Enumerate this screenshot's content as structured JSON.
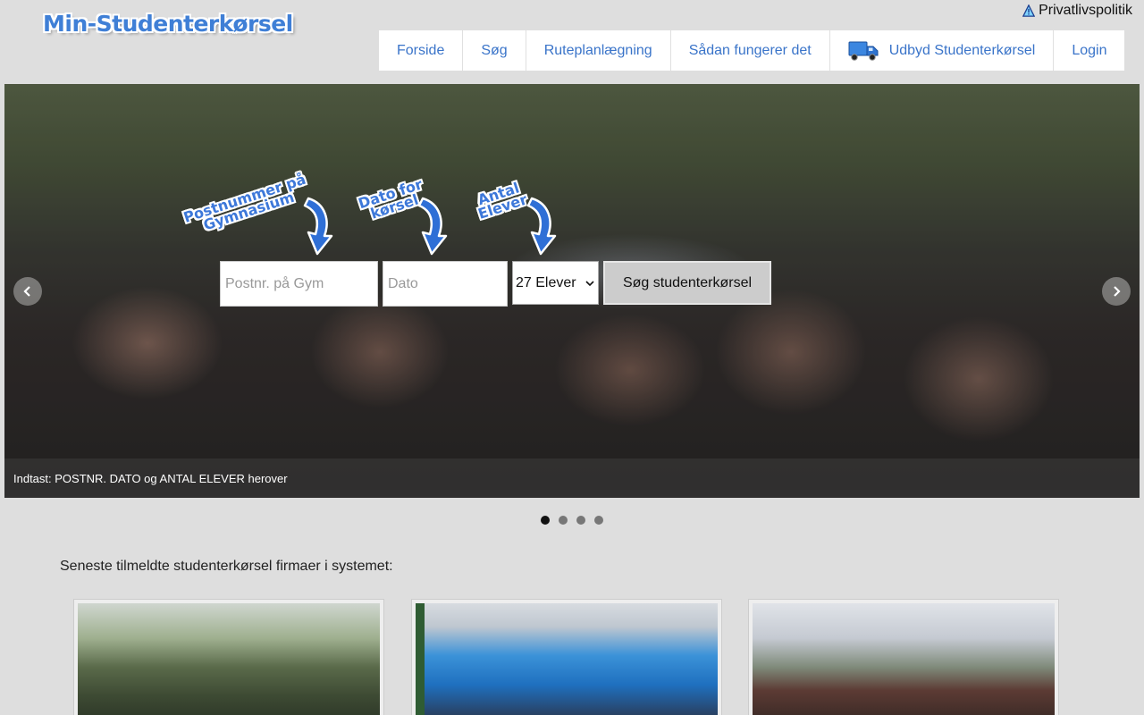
{
  "header": {
    "logo_text": "Min-Studenterkørsel",
    "privacy_link": "Privatlivspolitik",
    "nav": [
      {
        "label": "Forside"
      },
      {
        "label": "Søg"
      },
      {
        "label": "Ruteplanlægning"
      },
      {
        "label": "Sådan fungerer det"
      },
      {
        "label": "Udbyd Studenterkørsel",
        "icon": "truck-icon"
      },
      {
        "label": "Login"
      }
    ]
  },
  "hero": {
    "callouts": [
      "Postnummer på Gymnasium",
      "Dato for kørsel",
      "Antal Elever"
    ],
    "postnr_placeholder": "Postnr. på Gym",
    "date_placeholder": "Dato",
    "students_selected": "27 Elever",
    "search_button": "Søg studenterkørsel",
    "caption": "Indtast: POSTNR. DATO og ANTAL ELEVER herover",
    "slides_total": 4,
    "active_slide": 1
  },
  "latest": {
    "title": "Seneste tilmeldte studenterkørsel firmaer i systemet:",
    "cards": [
      {
        "image": "military-truck-photo"
      },
      {
        "image": "blue-truck-photo"
      },
      {
        "image": "fire-truck-photo"
      }
    ]
  },
  "colors": {
    "brand_blue": "#3a74c9",
    "background": "#dedede"
  }
}
